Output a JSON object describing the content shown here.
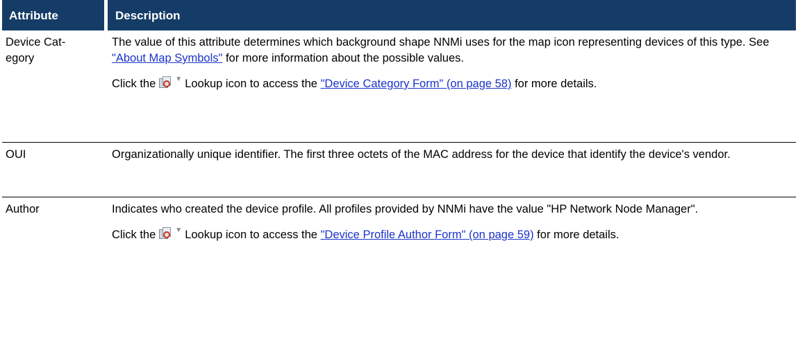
{
  "header": {
    "attribute_label": "Attribute",
    "description_label": "Description"
  },
  "rows": [
    {
      "attribute_line1": "Device Cat-",
      "attribute_line2": "egory",
      "p1_text": "The value of this attribute determines which background shape NNMi uses for the map icon representing devices of this type. See ",
      "p1_link": "\"About Map Symbols\"",
      "p1_after": " for more information about the possible values.",
      "p2_before": "Click the",
      "p2_icon_label": "Lookup icon to access the ",
      "p2_link": "\"Device Category Form\" (on page 58)",
      "p2_after": " for more details."
    },
    {
      "attribute": "OUI",
      "p1_text": "Organizationally unique identifier. The first three octets of the MAC address for the device that identify the device's vendor."
    },
    {
      "attribute": "Author",
      "p1_text": "Indicates who created the device profile. All profiles provided by NNMi have the value \"HP Network Node Manager\".",
      "p2_before": "Click the",
      "p2_icon_label": "Lookup icon to access the ",
      "p2_link": "\"Device Profile Author Form\" (on page 59)",
      "p2_after": " for more details."
    }
  ],
  "icons": {
    "lookup": "lookup-icon",
    "dropdown": "chevron-down-icon"
  },
  "colors": {
    "header_bg": "#143c66",
    "link": "#1a33c8"
  }
}
